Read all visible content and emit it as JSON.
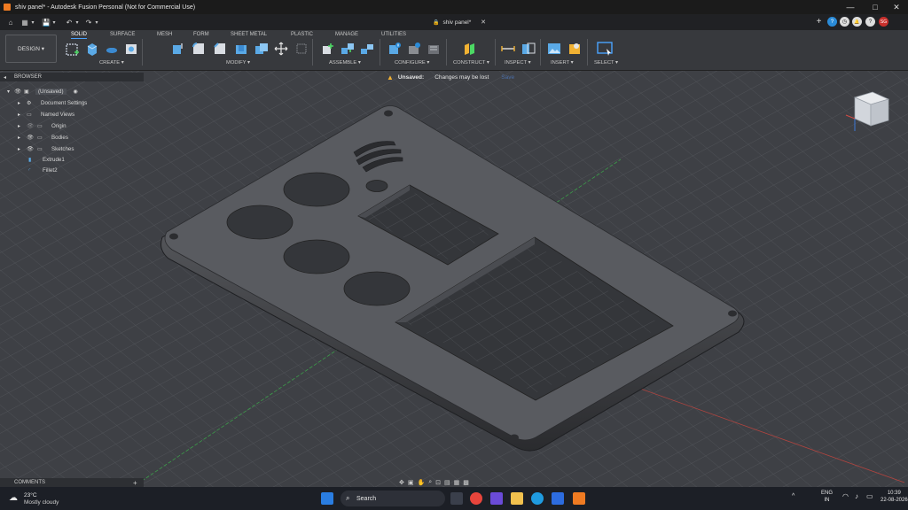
{
  "window": {
    "title": "shiv panel* - Autodesk Fusion Personal (Not for Commercial Use)",
    "doc_tab": "shiv panel*",
    "controls": [
      "—",
      "□",
      "✕"
    ]
  },
  "quick_access": [
    "⌂",
    "▦",
    "▾",
    "💾",
    "▾",
    "↶",
    "▾",
    "↷",
    "▾"
  ],
  "right_tools": [
    "+",
    "?",
    "◷",
    "🔔",
    "?",
    "SG"
  ],
  "ribbon": {
    "workspace": "DESIGN ▾",
    "tabs": [
      "SOLID",
      "SURFACE",
      "MESH",
      "FORM",
      "SHEET METAL",
      "PLASTIC",
      "MANAGE",
      "UTILITIES"
    ],
    "groups": [
      "CREATE ▾",
      "MODIFY ▾",
      "ASSEMBLE ▾",
      "CONFIGURE ▾",
      "CONSTRUCT ▾",
      "INSPECT ▾",
      "INSERT ▾",
      "SELECT ▾"
    ]
  },
  "warning": {
    "label": "Unsaved:",
    "message": "Changes may be lost",
    "action": "Save"
  },
  "browser": {
    "title": "BROWSER",
    "root": "(Unsaved)",
    "items": [
      "Document Settings",
      "Named Views",
      "Origin",
      "Bodies",
      "Sketches",
      "Extrude1",
      "Fillet2"
    ]
  },
  "comments": {
    "title": "COMMENTS"
  },
  "taskbar": {
    "weather_temp": "23°C",
    "weather_desc": "Mostly cloudy",
    "search": "Search",
    "lang": "ENG",
    "lang_sub": "IN",
    "time": "10:39",
    "date": "22-08-2026"
  },
  "colors": {
    "accent": "#4aa3ff",
    "warning": "#f2b233",
    "fusion_orange": "#f07b22"
  }
}
